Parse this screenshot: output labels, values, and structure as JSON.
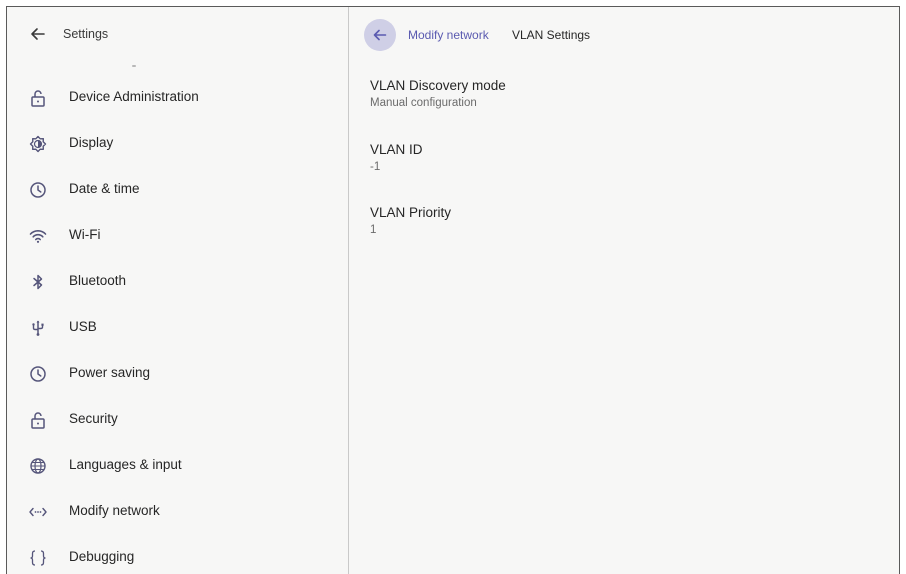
{
  "sidebar": {
    "title": "Settings",
    "items": [
      {
        "label": "Device Administration",
        "icon": "lock-open-icon"
      },
      {
        "label": "Display",
        "icon": "brightness-icon"
      },
      {
        "label": "Date & time",
        "icon": "clock-icon"
      },
      {
        "label": "Wi-Fi",
        "icon": "wifi-icon"
      },
      {
        "label": "Bluetooth",
        "icon": "bluetooth-icon"
      },
      {
        "label": "USB",
        "icon": "usb-icon"
      },
      {
        "label": "Power saving",
        "icon": "clock-icon"
      },
      {
        "label": "Security",
        "icon": "lock-open-icon"
      },
      {
        "label": "Languages & input",
        "icon": "globe-icon"
      },
      {
        "label": "Modify network",
        "icon": "network-arrows-icon"
      },
      {
        "label": "Debugging",
        "icon": "braces-icon"
      }
    ]
  },
  "header": {
    "breadcrumb_parent": "Modify network",
    "breadcrumb_current": "VLAN Settings"
  },
  "preferences": [
    {
      "title": "VLAN Discovery mode",
      "summary": "Manual configuration"
    },
    {
      "title": "VLAN ID",
      "summary": "-1"
    },
    {
      "title": "VLAN Priority",
      "summary": "1"
    }
  ],
  "colors": {
    "accent": "#5a5ab0",
    "back_button_bg": "#cfcfe6",
    "background": "#f7f7f6",
    "icon": "#55557a"
  }
}
